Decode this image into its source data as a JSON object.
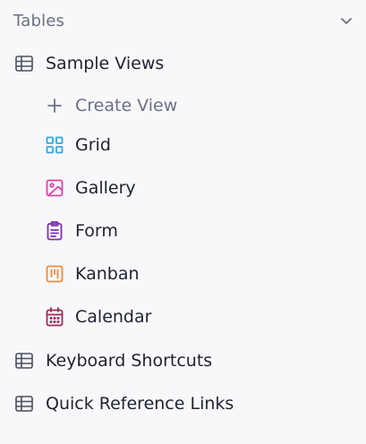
{
  "section": {
    "title": "Tables",
    "toggle_icon": "chevron-down-icon"
  },
  "tables": [
    {
      "label": "Sample Views",
      "icon": "table-grid-icon",
      "views": [
        {
          "label": "Create View",
          "icon": "plus-icon",
          "color": "#6b7084"
        },
        {
          "label": "Grid",
          "icon": "grid-view-icon",
          "color": "#2fa8e5"
        },
        {
          "label": "Gallery",
          "icon": "gallery-view-icon",
          "color": "#e83ea6"
        },
        {
          "label": "Form",
          "icon": "form-view-icon",
          "color": "#7b2fb5"
        },
        {
          "label": "Kanban",
          "icon": "kanban-view-icon",
          "color": "#f08a3c"
        },
        {
          "label": "Calendar",
          "icon": "calendar-view-icon",
          "color": "#a0295a"
        }
      ]
    },
    {
      "label": "Keyboard Shortcuts",
      "icon": "table-grid-icon",
      "views": []
    },
    {
      "label": "Quick Reference Links",
      "icon": "table-grid-icon",
      "views": []
    }
  ],
  "colors": {
    "table_icon": "#4b4f5c",
    "text": "#1f2330",
    "muted_text": "#6b7080",
    "background": "#f8f8fa"
  }
}
